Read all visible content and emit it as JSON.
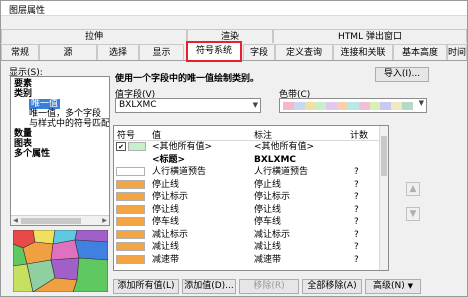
{
  "window": {
    "title": "图层属性"
  },
  "tab_groups": [
    {
      "label": "拉伸"
    },
    {
      "label": "渲染"
    },
    {
      "label": "HTML 弹出窗口"
    }
  ],
  "tabs": [
    {
      "label": "常规"
    },
    {
      "label": "源"
    },
    {
      "label": "选择"
    },
    {
      "label": "显示"
    },
    {
      "label": "符号系统",
      "active": true
    },
    {
      "label": "字段"
    },
    {
      "label": "定义查询"
    },
    {
      "label": "连接和关联"
    },
    {
      "label": "基本高度"
    },
    {
      "label": "时间"
    }
  ],
  "left": {
    "show_label": "显示(S):",
    "tree": [
      {
        "text": "要素",
        "bold": true
      },
      {
        "text": "类别",
        "bold": true
      },
      {
        "text": "唯一值",
        "selected": true
      },
      {
        "text": "唯一值，多个字段"
      },
      {
        "text": "与样式中的符号匹配"
      },
      {
        "text": "数量",
        "bold": true
      },
      {
        "text": "图表",
        "bold": true
      },
      {
        "text": "多个属性",
        "bold": true
      }
    ]
  },
  "right": {
    "description": "使用一个字段中的唯一值绘制类别。",
    "import_label": "导入(I)...",
    "value_field_label": "值字段(V)",
    "value_field_value": "BXLXMC",
    "color_ramp_label": "色带(C)",
    "color_ramp": [
      "#f5b8c8",
      "#c8d8f0",
      "#f0e0a8",
      "#c8f0c8",
      "#e0c8f0",
      "#f8d0b0",
      "#b8e8e8",
      "#f0c0d8",
      "#d8f0b0",
      "#c8c8f0",
      "#f0e8c0",
      "#b8d8c8"
    ],
    "table": {
      "headers": {
        "symbol": "符号",
        "value": "值",
        "label": "标注",
        "count": "计数"
      },
      "rows": [
        {
          "checked": true,
          "fill": "#c8f0c8",
          "value": "<其他所有值>",
          "label": "<其他所有值>",
          "count": "",
          "bold": false
        },
        {
          "checked": false,
          "fill": "",
          "value": "<标题>",
          "label": "BXLXMC",
          "count": "",
          "bold": true
        },
        {
          "checked": false,
          "fill": "#ffffff",
          "value": "人行横道预告",
          "label": "人行横道预告",
          "count": "?",
          "bold": false
        },
        {
          "checked": false,
          "fill": "#f4a442",
          "value": "停止线",
          "label": "停止线",
          "count": "?",
          "bold": false
        },
        {
          "checked": false,
          "fill": "#f4a442",
          "value": "停让标示",
          "label": "停让标示",
          "count": "?",
          "bold": false
        },
        {
          "checked": false,
          "fill": "#f4a442",
          "value": "停让线",
          "label": "停让线",
          "count": "?",
          "bold": false
        },
        {
          "checked": false,
          "fill": "#f4a442",
          "value": "停车线",
          "label": "停车线",
          "count": "?",
          "bold": false
        },
        {
          "checked": false,
          "fill": "#f4a442",
          "value": "减让标示",
          "label": "减让标示",
          "count": "?",
          "bold": false
        },
        {
          "checked": false,
          "fill": "#f4a442",
          "value": "减让线",
          "label": "减让线",
          "count": "?",
          "bold": false
        },
        {
          "checked": false,
          "fill": "#f4a442",
          "value": "减速带",
          "label": "减速带",
          "count": "?",
          "bold": false
        }
      ]
    },
    "buttons": {
      "add_all": "添加所有值(L)",
      "add": "添加值(D)...",
      "remove": "移除(R)",
      "remove_all": "全部移除(A)",
      "advanced": "高级(N)"
    }
  },
  "map_colors": [
    "#e84a4a",
    "#f0e060",
    "#60c8e0",
    "#a060c8",
    "#60c860",
    "#f0a040",
    "#e070c0",
    "#4080e0",
    "#c8e060",
    "#8fd0a0"
  ]
}
